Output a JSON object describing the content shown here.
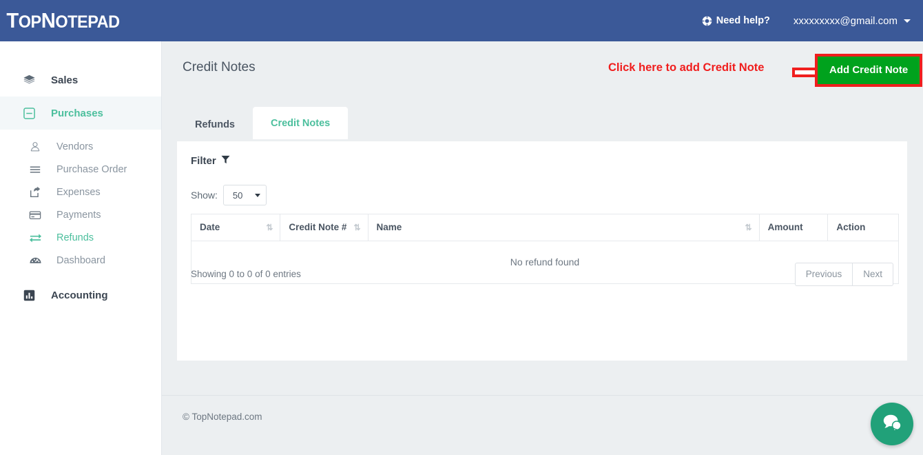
{
  "header": {
    "logo_top": "Top",
    "logo_note": "Notepad",
    "help_label": "Need help?",
    "help_icon": "lifebuoy-icon",
    "user_email": "xxxxxxxxx@gmail.com",
    "caret_icon": "caret-down-icon",
    "background_color": "#3b5998"
  },
  "sidebar": {
    "groups": [
      {
        "label": "Sales",
        "icon": "layers-icon",
        "active": false
      },
      {
        "label": "Purchases",
        "icon": "minus-square-icon",
        "active": true
      },
      {
        "label": "Accounting",
        "icon": "bar-chart-icon",
        "active": false
      }
    ],
    "items": [
      {
        "label": "Vendors",
        "icon": "user-circle-icon",
        "active": false
      },
      {
        "label": "Purchase Order",
        "icon": "list-icon",
        "active": false
      },
      {
        "label": "Expenses",
        "icon": "share-icon",
        "active": false
      },
      {
        "label": "Payments",
        "icon": "credit-card-icon",
        "active": false
      },
      {
        "label": "Refunds",
        "icon": "exchange-icon",
        "active": true
      },
      {
        "label": "Dashboard",
        "icon": "tachometer-icon",
        "active": false
      }
    ],
    "active_color": "#4cbf9d"
  },
  "main": {
    "page_title": "Credit Notes",
    "annotation": {
      "text": "Click here to add Credit Note",
      "color": "#f01e1e",
      "arrow_icon": "arrow-right-icon"
    },
    "add_button": {
      "label": "Add Credit Note",
      "background_color": "#00a21d",
      "highlight_border_color": "#f01e1e"
    },
    "tabs": [
      {
        "label": "Refunds",
        "active": false
      },
      {
        "label": "Credit Notes",
        "active": true
      }
    ],
    "filter": {
      "label": "Filter",
      "icon": "funnel-icon"
    },
    "show": {
      "label": "Show:",
      "value": "50",
      "caret_icon": "caret-down-icon"
    },
    "table": {
      "columns": [
        {
          "label": "Date",
          "sortable": true
        },
        {
          "label": "Credit Note #",
          "sortable": true
        },
        {
          "label": "Name",
          "sortable": true
        },
        {
          "label": "Amount",
          "sortable": false
        },
        {
          "label": "Action",
          "sortable": false
        }
      ],
      "sort_icon": "sort-updown-icon",
      "empty_message": "No refund found",
      "rows": []
    },
    "entries_text": "Showing 0 to 0 of 0 entries",
    "pagination": {
      "previous_label": "Previous",
      "next_label": "Next"
    }
  },
  "footer": {
    "copyright": "© TopNotepad.com"
  },
  "chat": {
    "icon": "chat-bubbles-icon",
    "color": "#21a179"
  }
}
